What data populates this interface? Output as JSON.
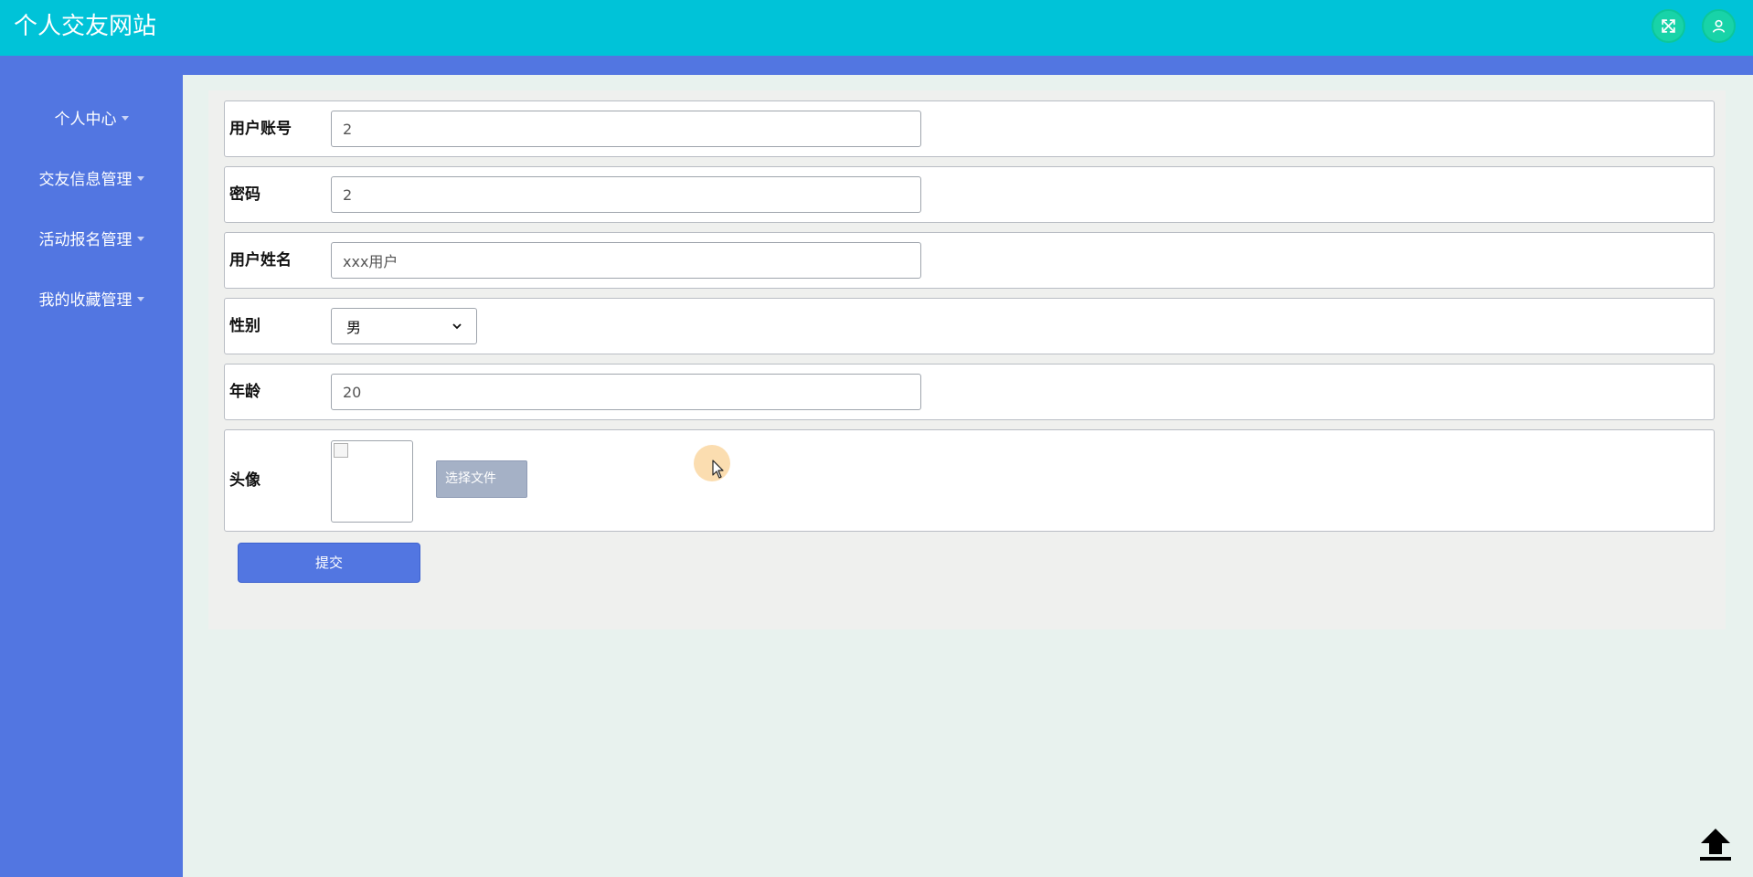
{
  "header": {
    "title": "个人交友网站",
    "icons": [
      "fullscreen-icon",
      "user-icon"
    ]
  },
  "sidebar": {
    "items": [
      {
        "label": "个人中心"
      },
      {
        "label": "交友信息管理"
      },
      {
        "label": "活动报名管理"
      },
      {
        "label": "我的收藏管理"
      }
    ]
  },
  "form": {
    "account": {
      "label": "用户账号",
      "value": "2"
    },
    "password": {
      "label": "密码",
      "value": "2"
    },
    "name": {
      "label": "用户姓名",
      "value": "xxx用户"
    },
    "gender": {
      "label": "性别",
      "value": "男"
    },
    "age": {
      "label": "年龄",
      "value": "20"
    },
    "avatar": {
      "label": "头像",
      "button_label": "选择文件"
    },
    "submit_label": "提交"
  },
  "colors": {
    "header_bg": "#00c3d8",
    "sidebar_bg": "#5276e1",
    "icon_bg": "#18d3a8",
    "file_button_bg": "#a5b1c6"
  }
}
